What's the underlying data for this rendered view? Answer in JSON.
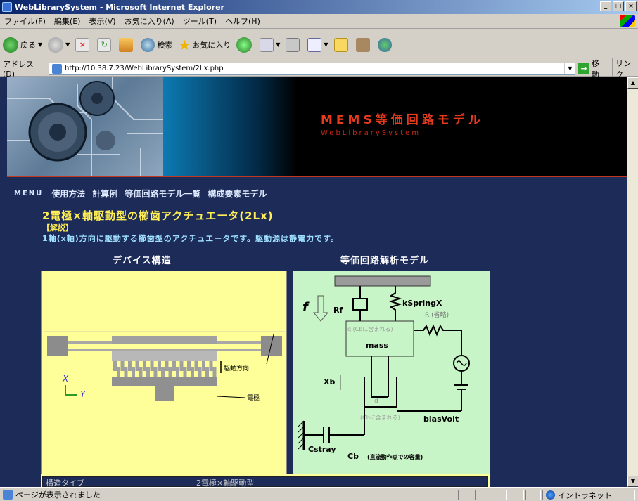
{
  "window": {
    "title": "WebLibrarySystem - Microsoft Internet Explorer"
  },
  "menubar": {
    "items": [
      "ファイル(F)",
      "編集(E)",
      "表示(V)",
      "お気に入り(A)",
      "ツール(T)",
      "ヘルプ(H)"
    ]
  },
  "toolbar": {
    "back_label": "戻る",
    "search_label": "検索",
    "favorites_label": "お気に入り"
  },
  "addressbar": {
    "label": "アドレス(D)",
    "url": "http://10.38.7.23/WebLibrarySystem/2Lx.php",
    "go_label": "移動",
    "links_label": "リンク"
  },
  "banner": {
    "title": "MEMS等価回路モデル",
    "subtitle": "WebLibrarySystem"
  },
  "nav": {
    "menu_label": "MENU",
    "links": [
      "使用方法",
      "計算例",
      "等価回路モデル一覧",
      "構成要素モデル"
    ]
  },
  "page": {
    "heading": "2電極×軸駆動型の櫛歯アクチュエータ(2Lx)",
    "explain_title": "【解説】",
    "explain_text": "1軸(x軸)方向に駆動する櫛歯型のアクチュエータです。駆動源は静電力です。",
    "col_left": "デバイス構造",
    "col_right": "等価回路解析モデル"
  },
  "device_diagram": {
    "axis_x": "X",
    "axis_y": "Y",
    "drive_direction": "駆動方向",
    "electrode": "電極"
  },
  "circuit": {
    "f": "f",
    "rf": "Rf",
    "kspring": "kSpringX",
    "r": "R (省略)",
    "q": "q (Cbに含まれる)",
    "mass": "mass",
    "xb": "Xb",
    "d": "d",
    "d_note": "(Cbに含まれる)",
    "bias": "biasVolt",
    "cstray": "Cstray",
    "cb": "Cb",
    "cb_note": "(直流動作点での容量)"
  },
  "table": {
    "col1": "構造タイプ",
    "col2": "2電極×軸駆動型"
  },
  "status": {
    "text": "ページが表示されました",
    "zone": "イントラネット"
  }
}
